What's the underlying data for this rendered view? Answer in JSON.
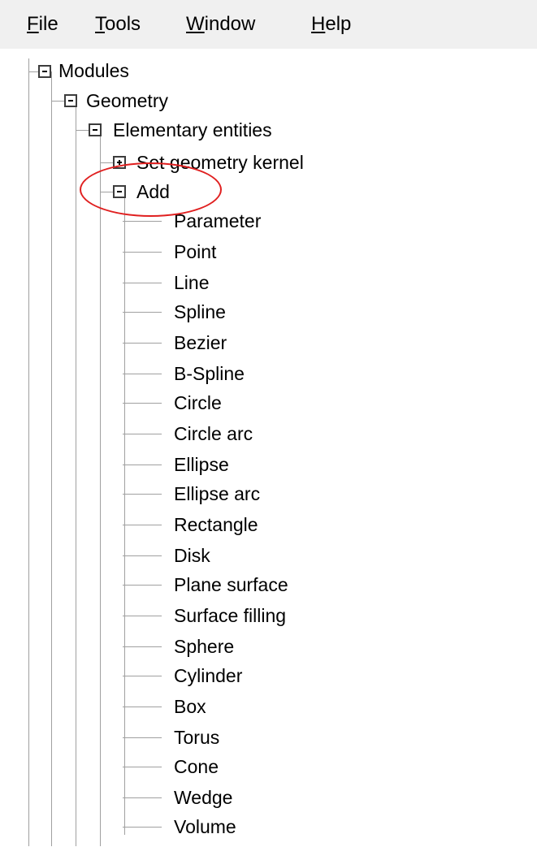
{
  "menu": {
    "file": {
      "mnemonic": "F",
      "rest": "ile"
    },
    "tools": {
      "mnemonic": "T",
      "rest": "ools"
    },
    "window": {
      "mnemonic": "W",
      "rest": "indow"
    },
    "help": {
      "mnemonic": "H",
      "rest": "elp"
    }
  },
  "tree": {
    "modules": {
      "label": "Modules",
      "state": "expanded"
    },
    "geometry": {
      "label": "Geometry",
      "state": "expanded"
    },
    "elementary": {
      "label": "Elementary entities",
      "state": "expanded"
    },
    "set_kernel": {
      "label": "Set geometry kernel",
      "state": "collapsed"
    },
    "add": {
      "label": "Add",
      "state": "expanded",
      "highlighted": true
    },
    "add_items": [
      "Parameter",
      "Point",
      "Line",
      "Spline",
      "Bezier",
      "B-Spline",
      "Circle",
      "Circle arc",
      "Ellipse",
      "Ellipse arc",
      "Rectangle",
      "Disk",
      "Plane surface",
      "Surface filling",
      "Sphere",
      "Cylinder",
      "Box",
      "Torus",
      "Cone",
      "Wedge",
      "Volume"
    ]
  },
  "colors": {
    "menubar_bg": "#f0f0f0",
    "tree_lines": "#a0a0a0",
    "highlight": "#e02020"
  }
}
